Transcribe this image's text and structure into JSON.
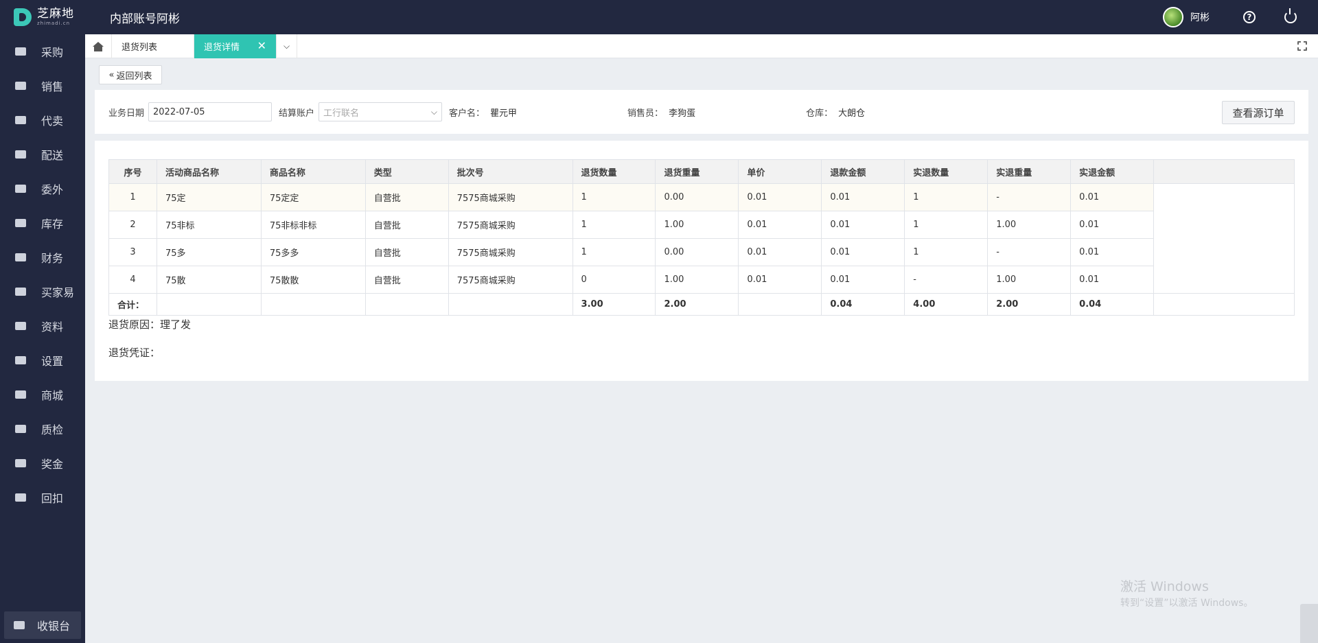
{
  "header": {
    "logo_cn": "芝麻地",
    "logo_en": "zhimadi.cn",
    "company": "内部账号阿彬",
    "user": "阿彬"
  },
  "sidebar": {
    "items": [
      {
        "label": "采购",
        "icon": "basket-icon"
      },
      {
        "label": "销售",
        "icon": "cart-icon"
      },
      {
        "label": "代卖",
        "icon": "tag-icon"
      },
      {
        "label": "配送",
        "icon": "truck-icon"
      },
      {
        "label": "委外",
        "icon": "warehouse-icon"
      },
      {
        "label": "库存",
        "icon": "store-icon"
      },
      {
        "label": "财务",
        "icon": "yen-icon"
      },
      {
        "label": "买家易",
        "icon": "shop-icon"
      },
      {
        "label": "资料",
        "icon": "printer-icon"
      },
      {
        "label": "设置",
        "icon": "gear-icon"
      },
      {
        "label": "商城",
        "icon": "mall-icon"
      },
      {
        "label": "质检",
        "icon": "basket-icon"
      },
      {
        "label": "奖金",
        "icon": "shop-icon"
      },
      {
        "label": "回扣",
        "icon": "warehouse-icon"
      }
    ],
    "cashier": "收银台"
  },
  "tabs": {
    "list": "退货列表",
    "active": "退货详情",
    "close": "✕",
    "dropdown": "⌵"
  },
  "back_button": "返回列表",
  "filter": {
    "date_label": "业务日期",
    "date_value": "2022-07-05",
    "account_label": "结算账户",
    "account_placeholder": "工行联名",
    "customer_label": "客户名：",
    "customer_value": "瞿元甲",
    "salesman_label": "销售员：",
    "salesman_value": "李狗蛋",
    "warehouse_label": "仓库：",
    "warehouse_value": "大朗仓",
    "view_source_button": "查看源订单"
  },
  "table": {
    "headers": [
      "序号",
      "活动商品名称",
      "商品名称",
      "类型",
      "批次号",
      "退货数量",
      "退货重量",
      "单价",
      "退款金额",
      "实退数量",
      "实退重量",
      "实退金额"
    ],
    "rows": [
      [
        "1",
        "75定",
        "75定定",
        "自营批",
        "7575商城采购",
        "1",
        "0.00",
        "0.01",
        "0.01",
        "1",
        "-",
        "0.01"
      ],
      [
        "2",
        "75非标",
        "75非标非标",
        "自营批",
        "7575商城采购",
        "1",
        "1.00",
        "0.01",
        "0.01",
        "1",
        "1.00",
        "0.01"
      ],
      [
        "3",
        "75多",
        "75多多",
        "自营批",
        "7575商城采购",
        "1",
        "0.00",
        "0.01",
        "0.01",
        "1",
        "-",
        "0.01"
      ],
      [
        "4",
        "75散",
        "75散散",
        "自营批",
        "7575商城采购",
        "0",
        "1.00",
        "0.01",
        "0.01",
        "-",
        "1.00",
        "0.01"
      ]
    ],
    "total": [
      "合计：",
      "",
      "",
      "",
      "",
      "3.00",
      "2.00",
      "",
      "0.04",
      "4.00",
      "2.00",
      "0.04"
    ]
  },
  "reason": "退货原因：理了发",
  "voucher": "退货凭证：",
  "watermark": {
    "line1": "激活 Windows",
    "line2": "转到“设置”以激活 Windows。"
  }
}
